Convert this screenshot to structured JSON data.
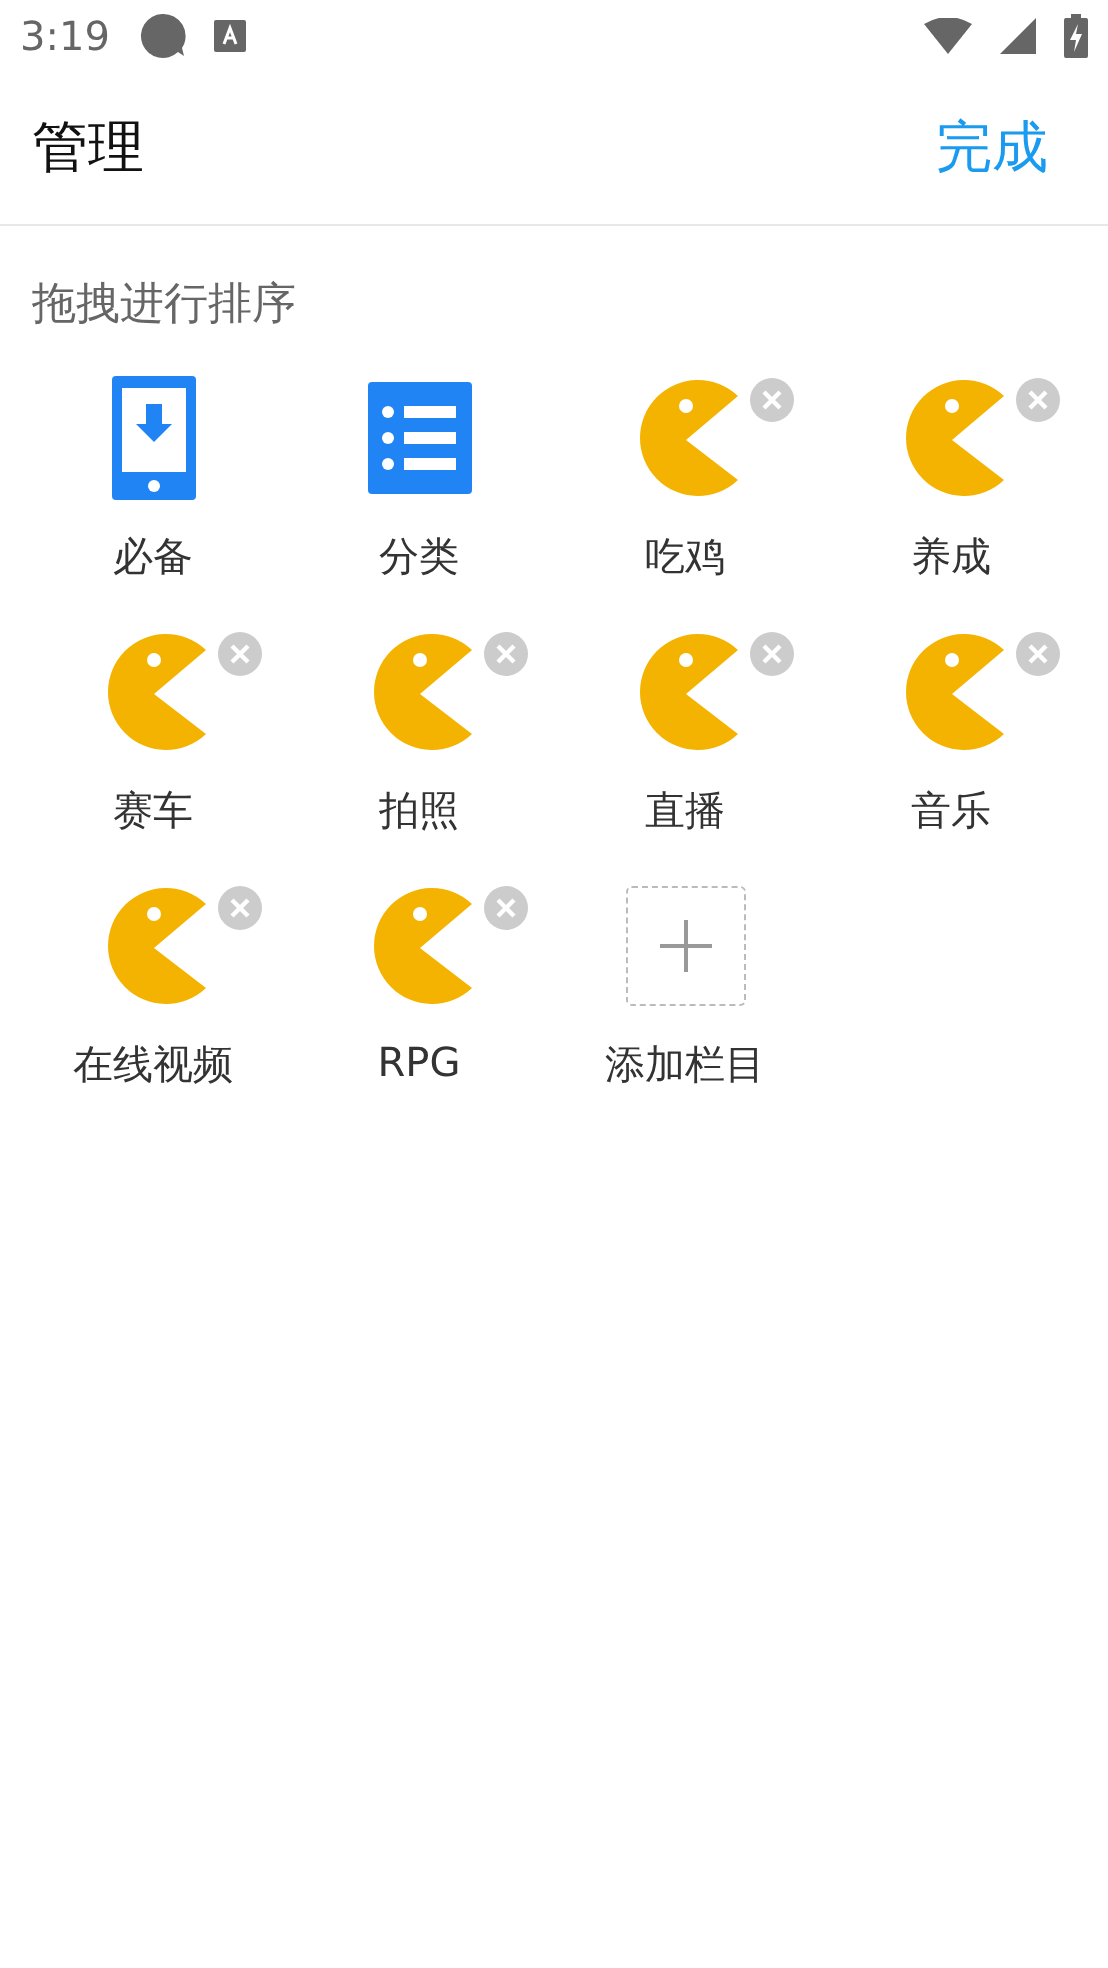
{
  "status_bar": {
    "time": "3:19"
  },
  "header": {
    "title": "管理",
    "action": "完成"
  },
  "section": {
    "title": "拖拽进行排序"
  },
  "items": [
    {
      "label": "必备",
      "kind": "phone",
      "removable": false
    },
    {
      "label": "分类",
      "kind": "list",
      "removable": false
    },
    {
      "label": "吃鸡",
      "kind": "pacman",
      "removable": true
    },
    {
      "label": "养成",
      "kind": "pacman",
      "removable": true
    },
    {
      "label": "赛车",
      "kind": "pacman",
      "removable": true
    },
    {
      "label": "拍照",
      "kind": "pacman",
      "removable": true
    },
    {
      "label": "直播",
      "kind": "pacman",
      "removable": true
    },
    {
      "label": "音乐",
      "kind": "pacman",
      "removable": true
    },
    {
      "label": "在线视频",
      "kind": "pacman",
      "removable": true
    },
    {
      "label": "RPG",
      "kind": "pacman",
      "removable": true
    },
    {
      "label": "添加栏目",
      "kind": "add",
      "removable": false
    }
  ]
}
